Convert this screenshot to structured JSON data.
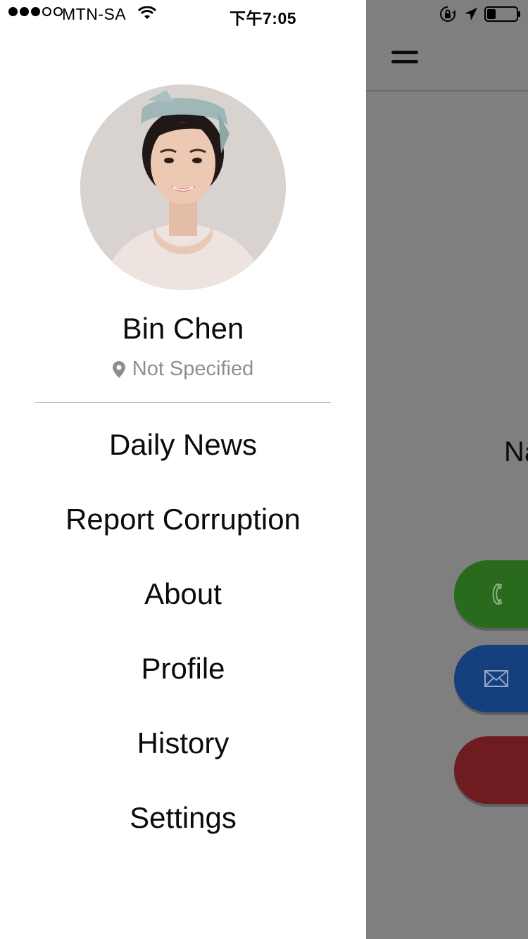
{
  "status_bar": {
    "carrier": "MTN-SA",
    "time": "下午7:05",
    "signal_bars_filled": 3,
    "signal_bars_total": 5,
    "battery_level": 0.3,
    "icons": [
      "wifi-icon",
      "orientation-lock-icon",
      "location-arrow-icon",
      "battery-icon"
    ]
  },
  "drawer": {
    "user": {
      "name": "Bin Chen",
      "location": "Not Specified",
      "avatar": "user-photo"
    },
    "menu": [
      {
        "label": "Daily News"
      },
      {
        "label": "Report Corruption"
      },
      {
        "label": "About"
      },
      {
        "label": "Profile"
      },
      {
        "label": "History"
      },
      {
        "label": "Settings"
      }
    ]
  },
  "main_screen": {
    "title_fragment": "Na",
    "buttons": [
      {
        "name": "call-button",
        "icon": "phone-icon",
        "color": "#2a6a1d"
      },
      {
        "name": "email-button",
        "icon": "envelope-icon",
        "color": "#153f7d"
      },
      {
        "name": "red-button",
        "icon": "",
        "color": "#6e1c20"
      }
    ]
  },
  "colors": {
    "overlay": "#7f7f7f",
    "drawer_bg": "#ffffff",
    "secondary_text": "#8e8e8e"
  }
}
